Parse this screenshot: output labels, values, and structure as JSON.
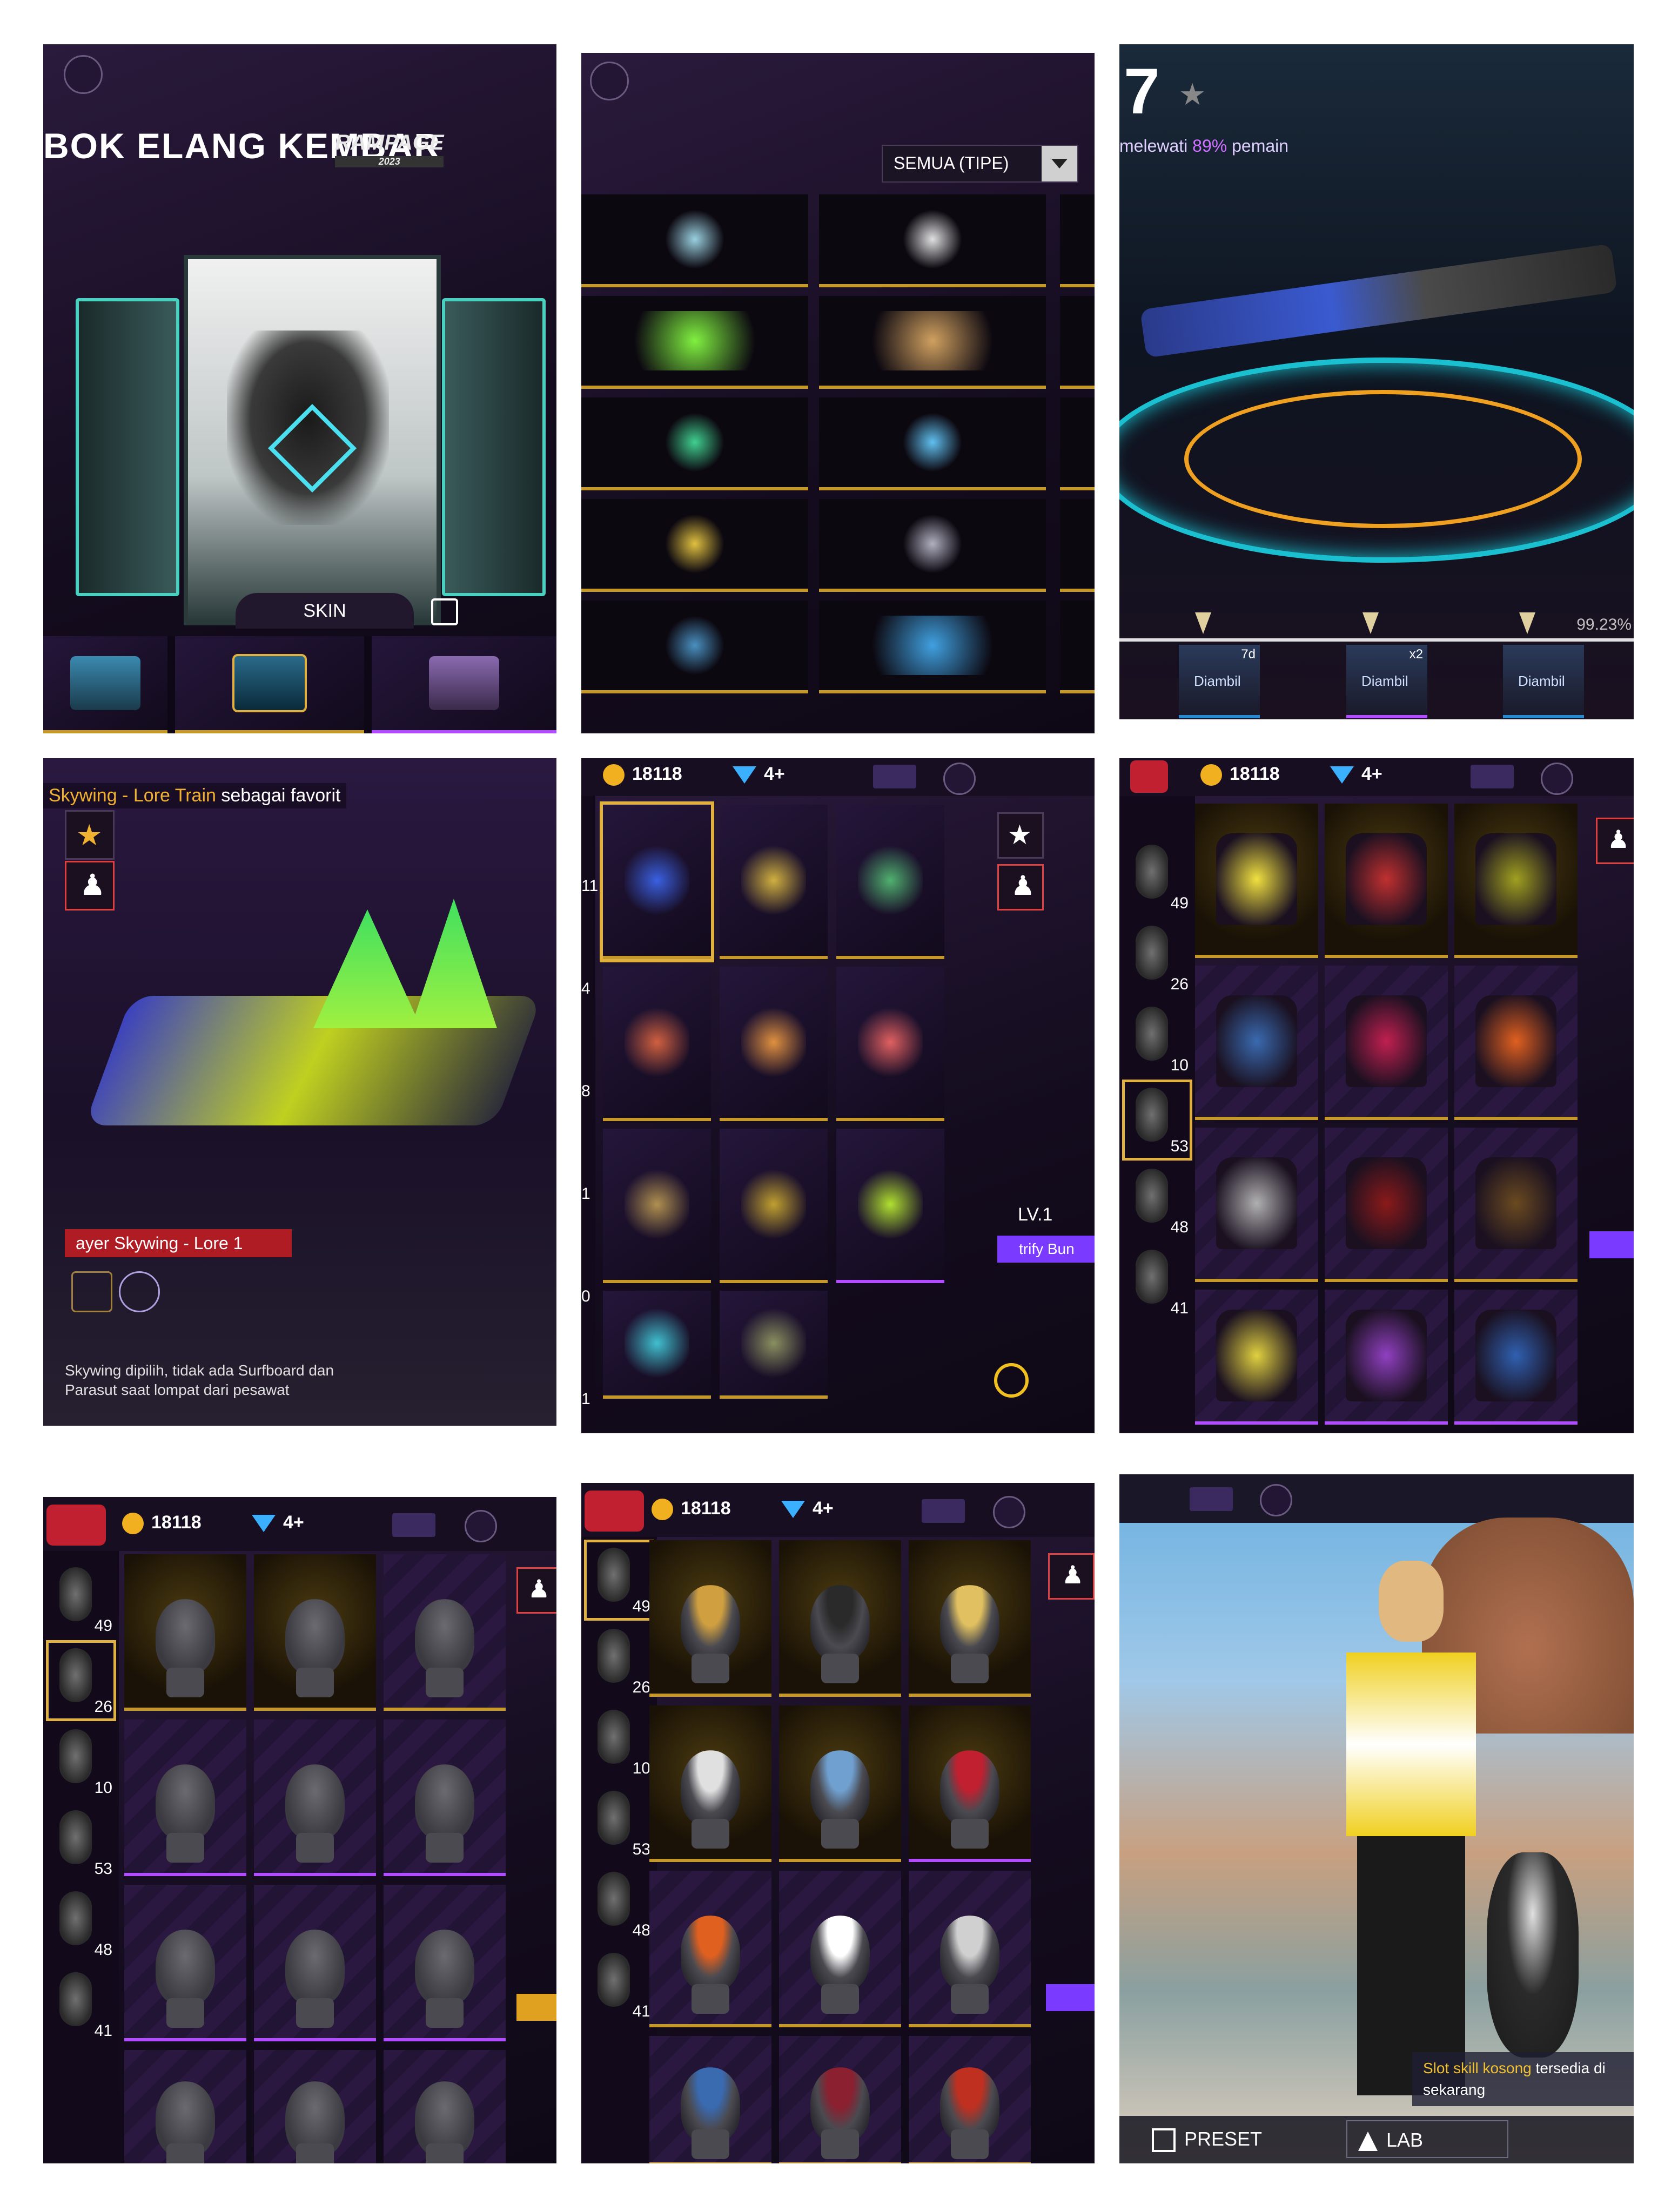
{
  "panel1": {
    "title": "BOK ELANG KEMBAR",
    "rampage_logo": "RAMPAGE",
    "rampage_year": "2023",
    "skin_label": "SKIN"
  },
  "panel2": {
    "filter_label": "SEMUA (TIPE)"
  },
  "panel3": {
    "rank_number": "7",
    "progress_text_prefix": "melewati ",
    "progress_percent": "89%",
    "progress_text_suffix": " pemain",
    "completion_percent": "99.23%",
    "rewards": [
      {
        "badge": "7d",
        "label": "Diambil"
      },
      {
        "badge": "x2",
        "label": "Diambil"
      },
      {
        "badge": "",
        "label": "Diambil"
      }
    ]
  },
  "panel4": {
    "favorite_prefix": "Skywing - Lore Train",
    "favorite_suffix": " sebagai favorit",
    "name_tag": "ayer Skywing - Lore 1",
    "description": "Skywing dipilih, tidak ada Surfboard dan Parasut saat lompat dari pesawat"
  },
  "currency": {
    "coins": "18118",
    "diamonds": "4+"
  },
  "panel5": {
    "side_numbers": [
      "11",
      "4",
      "8",
      "1",
      "0",
      "1"
    ],
    "level": "LV.1",
    "bundle_label": "trify Bun"
  },
  "panel6": {
    "side_numbers": [
      "49",
      "26",
      "10",
      "53",
      "48",
      "41"
    ]
  },
  "panel7": {
    "side_numbers": [
      "49",
      "26",
      "10",
      "53",
      "48",
      "41"
    ]
  },
  "panel8": {
    "side_numbers": [
      "49",
      "26",
      "10",
      "53",
      "48",
      "41"
    ]
  },
  "panel9": {
    "toast": "Slot skill kosong",
    "toast_suffix": " tersedia di",
    "toast_line2": "sekarang",
    "preset_label": "PRESET",
    "lab_label": "LAB"
  },
  "colors": {
    "gold_border": "#c4982a",
    "purple_border": "#b14dff",
    "accent_purple": "#7a3aff",
    "name_tag_red": "#b01c24"
  }
}
